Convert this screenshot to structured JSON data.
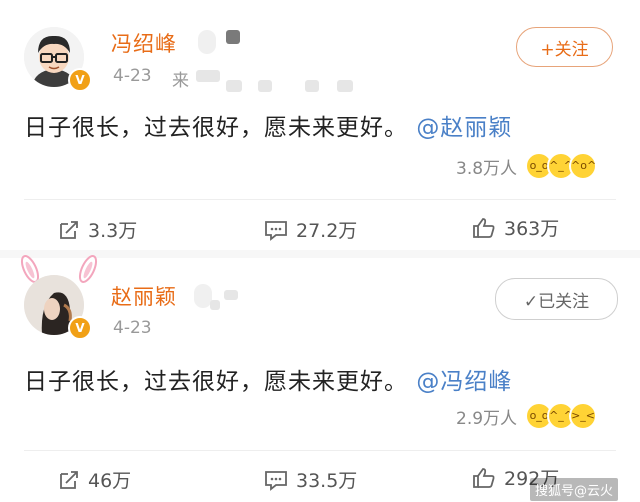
{
  "posts": [
    {
      "username": "冯绍峰",
      "date": "4-23",
      "date_suffix": "来",
      "verified_badge": "V",
      "follow_label": "+关注",
      "text": "日子很长，过去很好，愿未来更好。",
      "mention": "@赵丽颖",
      "reactions": "3.8万人",
      "actions": {
        "share": "3.3万",
        "comment": "27.2万",
        "like": "363万"
      }
    },
    {
      "username": "赵丽颖",
      "date": "4-23",
      "verified_badge": "V",
      "follow_label": "✓已关注",
      "text": "日子很长，过去很好，愿未来更好。",
      "mention": "@冯绍峰",
      "reactions": "2.9万人",
      "actions": {
        "share": "46万",
        "comment": "33.5万",
        "like": "292万"
      }
    }
  ],
  "watermark": "搜狐号@云火",
  "colors": {
    "username": "#e86c17",
    "mention": "#4a80c7",
    "badge": "#f1a016"
  }
}
